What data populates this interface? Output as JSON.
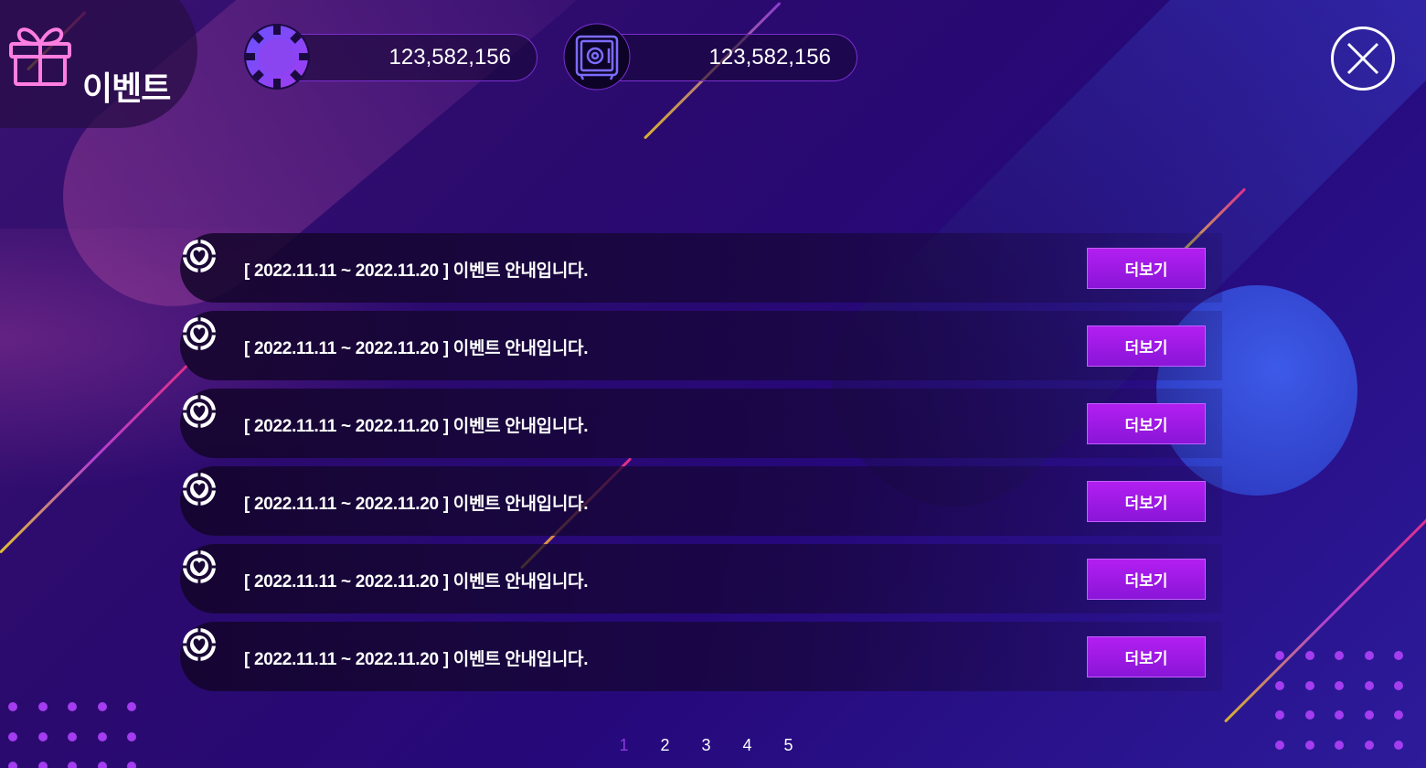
{
  "header": {
    "title": "이벤트",
    "title_icon": "gift-icon",
    "chip_balance": "123,582,156",
    "safe_balance": "123,582,156",
    "close_icon": "close-icon"
  },
  "events": [
    {
      "text": "[ 2022.11.11 ~ 2022.11.20 ] 이벤트 안내입니다.",
      "button": "더보기"
    },
    {
      "text": "[ 2022.11.11 ~ 2022.11.20 ] 이벤트 안내입니다.",
      "button": "더보기"
    },
    {
      "text": "[ 2022.11.11 ~ 2022.11.20 ] 이벤트 안내입니다.",
      "button": "더보기"
    },
    {
      "text": "[ 2022.11.11 ~ 2022.11.20 ] 이벤트 안내입니다.",
      "button": "더보기"
    },
    {
      "text": "[ 2022.11.11 ~ 2022.11.20 ] 이벤트 안내입니다.",
      "button": "더보기"
    },
    {
      "text": "[ 2022.11.11 ~ 2022.11.20 ] 이벤트 안내입니다.",
      "button": "더보기"
    }
  ],
  "pagination": {
    "pages": [
      "1",
      "2",
      "3",
      "4",
      "5"
    ],
    "current": "1"
  },
  "colors": {
    "accent": "#a818ee",
    "active_page": "#8a3ce0",
    "background": "#2a0a6e"
  }
}
